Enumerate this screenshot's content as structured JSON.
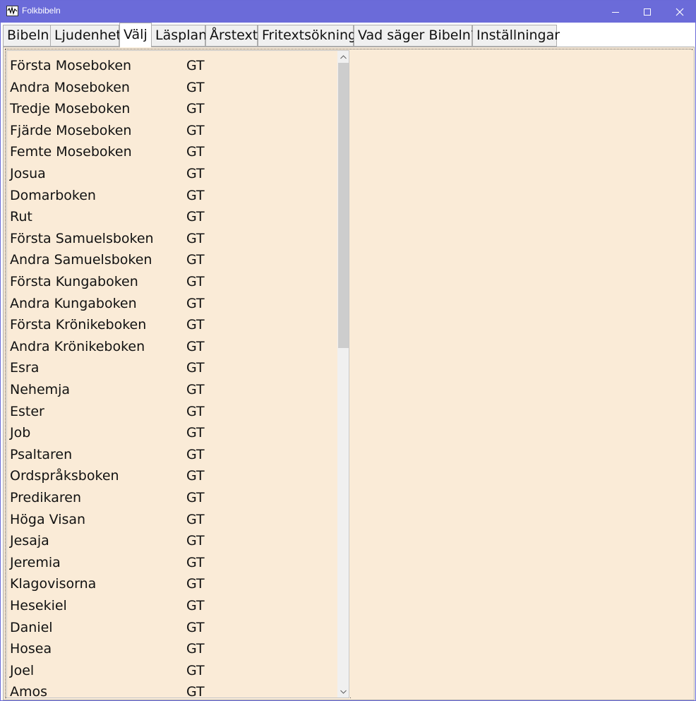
{
  "window": {
    "title": "Folkbibeln",
    "icon": "app-logo-icon",
    "controls": [
      "minimize-icon",
      "maximize-icon",
      "close-icon"
    ],
    "titlebar_color": "#6b6bd9"
  },
  "tabs": [
    {
      "label": "Bibeln",
      "active": false
    },
    {
      "label": "Ljudenhet",
      "active": false
    },
    {
      "label": "Välj",
      "active": true
    },
    {
      "label": "Läsplan",
      "active": false
    },
    {
      "label": "Årstext",
      "active": false
    },
    {
      "label": "Fritextsökning",
      "active": false
    },
    {
      "label": "Vad säger Bibeln?",
      "active": false
    },
    {
      "label": "Inställningar",
      "active": false
    }
  ],
  "books": [
    {
      "name": "Första Moseboken",
      "testament": "GT"
    },
    {
      "name": "Andra Moseboken",
      "testament": "GT"
    },
    {
      "name": "Tredje Moseboken",
      "testament": "GT"
    },
    {
      "name": "Fjärde Moseboken",
      "testament": "GT"
    },
    {
      "name": "Femte Moseboken",
      "testament": "GT"
    },
    {
      "name": "Josua",
      "testament": "GT"
    },
    {
      "name": "Domarboken",
      "testament": "GT"
    },
    {
      "name": "Rut",
      "testament": "GT"
    },
    {
      "name": "Första Samuelsboken",
      "testament": "GT"
    },
    {
      "name": "Andra Samuelsboken",
      "testament": "GT"
    },
    {
      "name": "Första Kungaboken",
      "testament": "GT"
    },
    {
      "name": "Andra Kungaboken",
      "testament": "GT"
    },
    {
      "name": "Första Krönikeboken",
      "testament": "GT"
    },
    {
      "name": "Andra Krönikeboken",
      "testament": "GT"
    },
    {
      "name": "Esra",
      "testament": "GT"
    },
    {
      "name": "Nehemja",
      "testament": "GT"
    },
    {
      "name": "Ester",
      "testament": "GT"
    },
    {
      "name": "Job",
      "testament": "GT"
    },
    {
      "name": "Psaltaren",
      "testament": "GT"
    },
    {
      "name": "Ordspråksboken",
      "testament": "GT"
    },
    {
      "name": "Predikaren",
      "testament": "GT"
    },
    {
      "name": "Höga Visan",
      "testament": "GT"
    },
    {
      "name": "Jesaja",
      "testament": "GT"
    },
    {
      "name": "Jeremia",
      "testament": "GT"
    },
    {
      "name": "Klagovisorna",
      "testament": "GT"
    },
    {
      "name": "Hesekiel",
      "testament": "GT"
    },
    {
      "name": "Daniel",
      "testament": "GT"
    },
    {
      "name": "Hosea",
      "testament": "GT"
    },
    {
      "name": "Joel",
      "testament": "GT"
    },
    {
      "name": "Amos",
      "testament": "GT"
    }
  ],
  "colors": {
    "content_background": "#faebd7",
    "scrollbar_track": "#f0f0f0",
    "scrollbar_thumb": "#cdcdcd"
  }
}
